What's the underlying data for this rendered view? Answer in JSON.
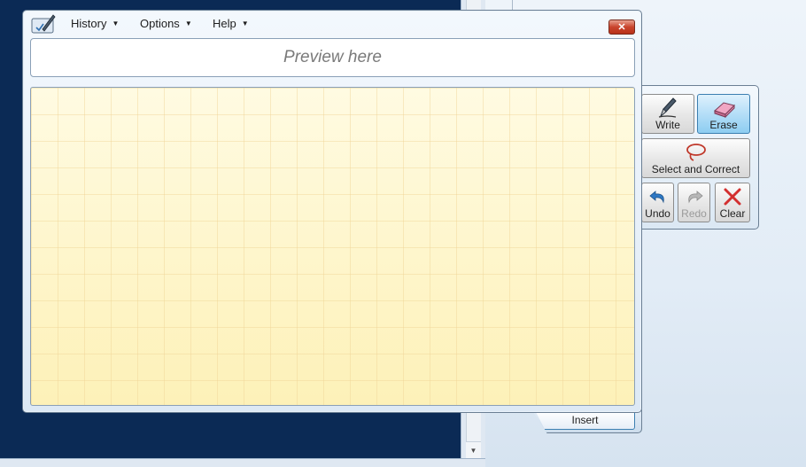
{
  "menubar": {
    "items": [
      {
        "label": "History"
      },
      {
        "label": "Options"
      },
      {
        "label": "Help"
      }
    ],
    "close_label": "✕"
  },
  "preview": {
    "placeholder": "Preview here"
  },
  "tools": {
    "write": "Write",
    "erase": "Erase",
    "select_correct": "Select and Correct",
    "undo": "Undo",
    "redo": "Redo",
    "clear": "Clear"
  },
  "insert": {
    "label": "Insert"
  },
  "colors": {
    "accent": "#3c7fb1",
    "pad": "#fdf6cf",
    "desktop": "#0b2a55"
  }
}
